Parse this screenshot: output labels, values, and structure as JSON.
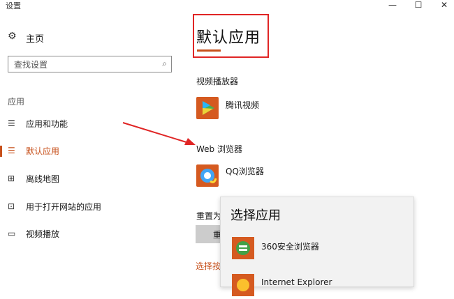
{
  "window": {
    "title": "设置",
    "minimize": "—",
    "maximize": "☐",
    "close": "✕"
  },
  "sidebar": {
    "home": {
      "icon": "gear-icon",
      "glyph": "⚙",
      "label": "主页"
    },
    "search": {
      "placeholder": "查找设置",
      "icon": "search-icon",
      "glyph": "⌕"
    },
    "section": "应用",
    "items": [
      {
        "label": "应用和功能",
        "icon": "apps-features-icon",
        "glyph": "☰",
        "active": false
      },
      {
        "label": "默认应用",
        "icon": "default-apps-icon",
        "glyph": "☰",
        "active": true
      },
      {
        "label": "离线地图",
        "icon": "map-icon",
        "glyph": "⊞",
        "active": false
      },
      {
        "label": "用于打开网站的应用",
        "icon": "open-website-icon",
        "glyph": "⊡",
        "active": false
      },
      {
        "label": "视频播放",
        "icon": "video-icon",
        "glyph": "▭",
        "active": false
      }
    ]
  },
  "main": {
    "title": "默认应用",
    "video_player": {
      "label": "视频播放器",
      "app": "腾讯视频",
      "icon": "tencent-video-icon"
    },
    "web_browser": {
      "label": "Web 浏览器",
      "app": "QQ浏览器",
      "icon": "qq-browser-icon"
    },
    "reset_label": "重置为",
    "reset_button": "重",
    "choose_link": "选择按"
  },
  "flyout": {
    "title": "选择应用",
    "items": [
      {
        "label": "360安全浏览器",
        "icon": "360-browser-icon"
      },
      {
        "label": "Internet Explorer",
        "icon": "internet-explorer-icon"
      }
    ]
  },
  "colors": {
    "accent": "#c7501b",
    "annotation": "#e02525"
  }
}
